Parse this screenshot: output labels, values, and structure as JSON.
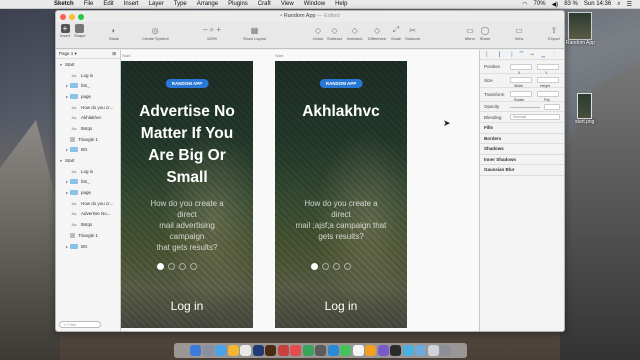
{
  "menubar": {
    "app": "Sketch",
    "items": [
      "File",
      "Edit",
      "Insert",
      "Layer",
      "Type",
      "Arrange",
      "Plugins",
      "Craft",
      "View",
      "Window",
      "Help"
    ],
    "battery": "70%",
    "volume": "83 %",
    "clock": "Sun 14:36"
  },
  "window": {
    "title": "Random App",
    "title_suffix": "— Edited"
  },
  "toolbar": {
    "insert": "Insert",
    "shape": "Shape",
    "mask": "Mask",
    "create_symbol": "Create Symbol",
    "zoom": "100%",
    "show_layout": "Show Layout",
    "union": "Union",
    "subtract": "Subtract",
    "intersect": "Intersect",
    "difference": "Difference",
    "scale": "Scale",
    "scissors": "Scissors",
    "mirror": "Mirror",
    "share": "Share",
    "view": "View",
    "export": "Export"
  },
  "sidebar": {
    "page": "Page 1",
    "search_placeholder": "Filter",
    "layers": [
      {
        "label": "Start",
        "type": "artboard"
      },
      {
        "label": "Log in",
        "type": "text"
      },
      {
        "label": "btn_",
        "type": "folder"
      },
      {
        "label": "page",
        "type": "folder"
      },
      {
        "label": "How do you cr...",
        "type": "text"
      },
      {
        "label": "Akhlakhvc",
        "type": "text"
      },
      {
        "label": "Bstqs",
        "type": "text"
      },
      {
        "label": "Triangle 1",
        "type": "shape"
      },
      {
        "label": "BG",
        "type": "folder"
      },
      {
        "label": "Start",
        "type": "artboard"
      },
      {
        "label": "Log in",
        "type": "text"
      },
      {
        "label": "btn_",
        "type": "folder"
      },
      {
        "label": "page",
        "type": "folder"
      },
      {
        "label": "How do you cr...",
        "type": "text"
      },
      {
        "label": "Advertise No...",
        "type": "text"
      },
      {
        "label": "Bstqs",
        "type": "text"
      },
      {
        "label": "Triangle 1",
        "type": "shape"
      },
      {
        "label": "BG",
        "type": "folder"
      }
    ]
  },
  "artboards": [
    {
      "label": "Start",
      "pill": "RANDOM APP",
      "headline": [
        "Advertise No",
        "Matter If You",
        "Are Big Or",
        "Small"
      ],
      "sub": [
        "How do you create a direct",
        "mail advertising campaign",
        "that gets results?"
      ],
      "login": "Log in"
    },
    {
      "label": "Start",
      "pill": "RANDOM APP",
      "headline": [
        "Akhlakhvc"
      ],
      "sub": [
        "How do you create a direct",
        "mail ;ajsf;a campaign that",
        "gets results?"
      ],
      "login": "Log in"
    }
  ],
  "inspector": {
    "position": "Position",
    "size": "Size",
    "width": "Width",
    "height": "Height",
    "transform": "Transform",
    "rotate": "Rotate",
    "flip": "Flip",
    "opacity": "Opacity",
    "blending": "Blending",
    "blending_value": "Normal",
    "x": "X",
    "y": "Y",
    "sections": [
      "Fills",
      "Borders",
      "Shadows",
      "Inner Shadows",
      "Gaussian Blur"
    ]
  },
  "desktop": {
    "file1": "Random App",
    "file2": "start.png"
  },
  "colors": {
    "accent": "#2a78d6",
    "folder": "#86c2ea"
  }
}
